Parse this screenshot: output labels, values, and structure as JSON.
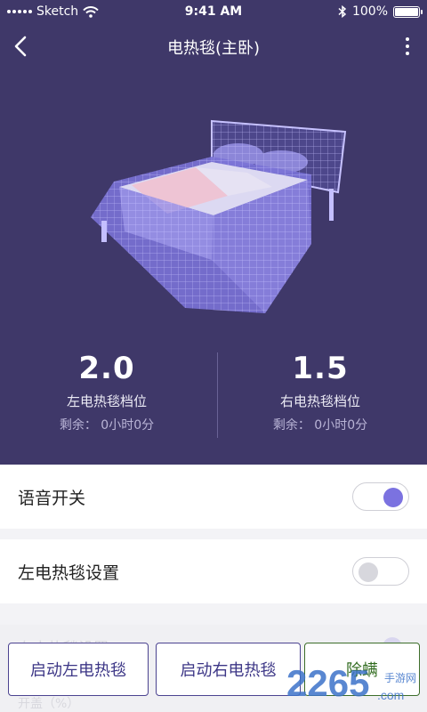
{
  "status": {
    "carrier": "Sketch",
    "time": "9:41 AM",
    "battery": "100%"
  },
  "nav": {
    "title": "电热毯(主卧)"
  },
  "left": {
    "value": "2.0",
    "label": "左电热毯档位",
    "remain": "剩余：  0小时0分"
  },
  "right": {
    "value": "1.5",
    "label": "右电热毯档位",
    "remain": "剩余：  0小时0分"
  },
  "settings": {
    "voice": {
      "label": "语音开关",
      "on": true
    },
    "left_blanket": {
      "label": "左电热毯设置",
      "on": false
    },
    "right_blanket": {
      "label": "右电热毯设置"
    },
    "partial": {
      "label": "开盖（%）"
    }
  },
  "buttons": {
    "start_left": "启动左电热毯",
    "start_right": "启动右电热毯",
    "mite": "除螨"
  },
  "watermark": {
    "main": "2265",
    "suffix": ".com",
    "sub": "手游网"
  },
  "colors": {
    "header_bg": "#3f3869",
    "accent": "#7b72e0",
    "button_text": "#3c3686"
  }
}
